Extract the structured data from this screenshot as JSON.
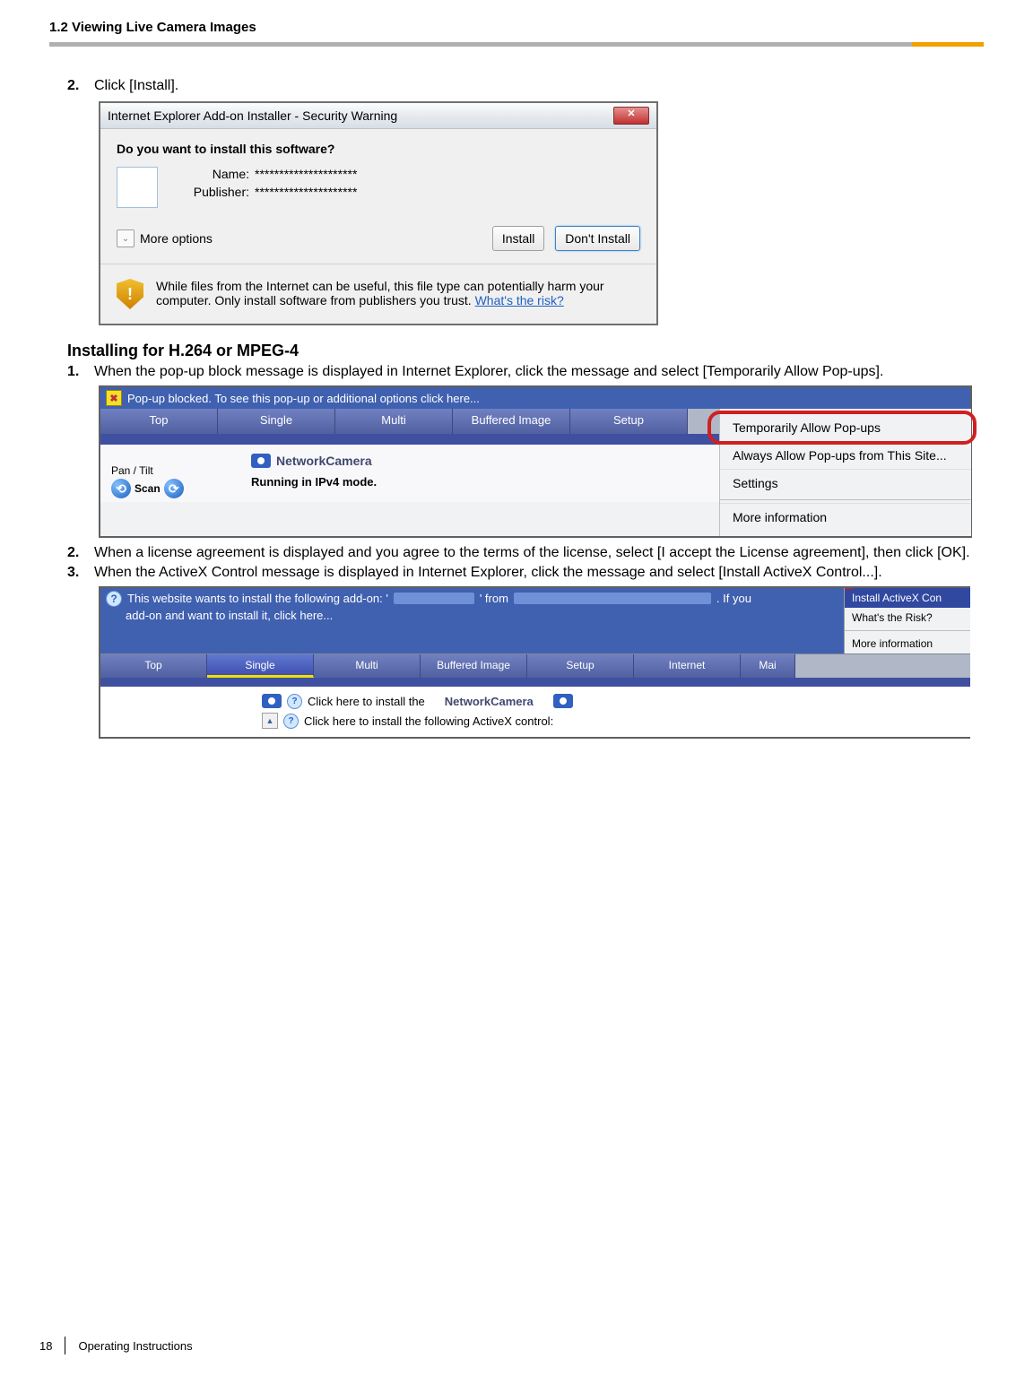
{
  "header": "1.2 Viewing Live Camera Images",
  "step2": {
    "num": "2.",
    "text": "Click [Install]."
  },
  "dialog1": {
    "title": "Internet Explorer Add-on Installer - Security Warning",
    "close": "✕",
    "question": "Do you want to install this software?",
    "nameLabel": "Name:",
    "nameValue": "*********************",
    "pubLabel": "Publisher:",
    "pubValue": "*********************",
    "more": "More options",
    "installBtn": "Install",
    "dontBtn": "Don't Install",
    "warnText": "While files from the Internet can be useful, this file type can potentially harm your computer. Only install software from publishers you trust. ",
    "warnLink": "What's the risk?"
  },
  "sectionB": {
    "title": "Installing for H.264 or MPEG-4",
    "step1": {
      "num": "1.",
      "text": "When the pop-up block message is displayed in Internet Explorer, click the message and select [Temporarily Allow Pop-ups]."
    },
    "step2": {
      "num": "2.",
      "text": "When a license agreement is displayed and you agree to the terms of the license, select [I accept the License agreement], then click [OK]."
    },
    "step3": {
      "num": "3.",
      "text": "When the ActiveX Control message is displayed in Internet Explorer, click the message and select [Install ActiveX Control...]."
    }
  },
  "shot2": {
    "msgbar": "Pop-up blocked. To see this pop-up or additional options click here...",
    "tabs": [
      "Top",
      "Single",
      "Multi",
      "Buffered Image",
      "Setup"
    ],
    "nc": "NetworkCamera",
    "pan": "Pan / Tilt",
    "scan": "Scan",
    "status": "Running in IPv4 mode.",
    "menu": {
      "temp": "Temporarily Allow Pop-ups",
      "always": "Always Allow Pop-ups from This Site...",
      "settings": "Settings",
      "more": "More information"
    }
  },
  "shot3": {
    "msg1a": "This website wants to install the following add-on: '",
    "msg1b": "' from",
    "msg1c": ". If you",
    "msg2": "add-on and want to install it, click here...",
    "menu": {
      "install": "Install ActiveX Con",
      "risk": "What's the Risk?",
      "more": "More information"
    },
    "tabs": [
      "Top",
      "Single",
      "Multi",
      "Buffered Image",
      "Setup",
      "Internet",
      "Mai"
    ],
    "row1a": "Click here to install the",
    "row1b": "NetworkCamera",
    "row2": "Click here to install the following ActiveX control:"
  },
  "footer": {
    "page": "18",
    "text": "Operating Instructions"
  }
}
